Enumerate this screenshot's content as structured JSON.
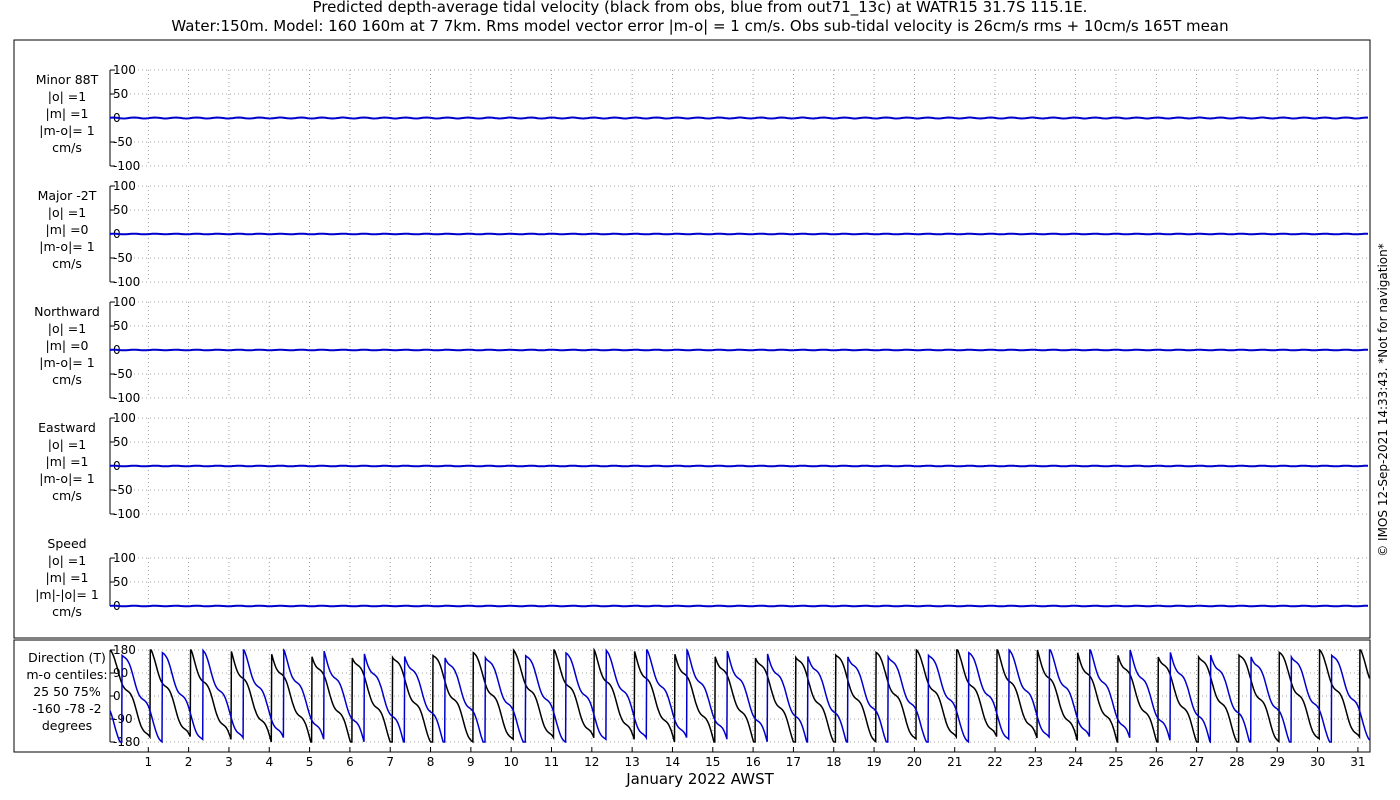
{
  "title_line1": "Predicted depth-average tidal velocity (black from obs, blue from out71_13c) at WATR15 31.7S 115.1E.",
  "title_line2": "Water:150m. Model: 160 160m at 7 7km. Rms model vector error |m-o| = 1 cm/s. Obs sub-tidal velocity is 26cm/s rms + 10cm/s 165T mean",
  "credit": "© IMOS 12-Sep-2021 14:33:43. *Not for navigation*",
  "colors": {
    "obs": "#000000",
    "model": "#0000cc",
    "grid": "#888888"
  },
  "chart_data": {
    "type": "line",
    "xlabel": "January 2022 AWST",
    "xlim": [
      0.05,
      31.3
    ],
    "x_tick_labels": [
      "1",
      "2",
      "3",
      "4",
      "5",
      "6",
      "7",
      "8",
      "9",
      "10",
      "11",
      "12",
      "13",
      "14",
      "15",
      "16",
      "17",
      "18",
      "19",
      "20",
      "21",
      "22",
      "23",
      "24",
      "25",
      "26",
      "27",
      "28",
      "29",
      "30",
      "31"
    ],
    "panels": [
      {
        "id": "minor",
        "label": [
          "Minor 88T",
          "|o| =1",
          "|m| =1",
          "|m-o|= 1",
          "cm/s"
        ],
        "ylim": [
          -100,
          100
        ],
        "yticks": [
          100,
          50,
          0,
          -50,
          -100
        ],
        "ytick_labels": [
          "100",
          "50",
          "0",
          "-50",
          "-100"
        ],
        "series": [
          {
            "type": "flat",
            "value": 0,
            "ripple": 1
          }
        ]
      },
      {
        "id": "major",
        "label": [
          "Major -2T",
          "|o| =1",
          "|m| =0",
          "|m-o|= 1",
          "cm/s"
        ],
        "ylim": [
          -100,
          100
        ],
        "yticks": [
          100,
          50,
          0,
          -50,
          -100
        ],
        "ytick_labels": [
          "100",
          "50",
          "0",
          "-50",
          "-100"
        ],
        "series": [
          {
            "type": "flat",
            "value": 0,
            "ripple": 0.5
          }
        ]
      },
      {
        "id": "north",
        "label": [
          "Northward",
          "|o| =1",
          "|m| =0",
          "|m-o|= 1",
          "cm/s"
        ],
        "ylim": [
          -100,
          100
        ],
        "yticks": [
          100,
          50,
          0,
          -50,
          -100
        ],
        "ytick_labels": [
          "100",
          "50",
          "0",
          "-50",
          "-100"
        ],
        "series": [
          {
            "type": "flat",
            "value": 0,
            "ripple": 0.5
          }
        ]
      },
      {
        "id": "east",
        "label": [
          "Eastward",
          "|o| =1",
          "|m| =1",
          "|m-o|= 1",
          "cm/s"
        ],
        "ylim": [
          -100,
          100
        ],
        "yticks": [
          100,
          50,
          0,
          -50,
          -100
        ],
        "ytick_labels": [
          "100",
          "50",
          "0",
          "-50",
          "-100"
        ],
        "series": [
          {
            "type": "flat",
            "value": 0,
            "ripple": 0.6
          }
        ]
      },
      {
        "id": "speed",
        "label": [
          "Speed",
          "|o| =1",
          "|m| =1",
          "|m|-|o|= 1",
          "cm/s"
        ],
        "ylim": [
          0,
          100
        ],
        "yticks": [
          100,
          50,
          0
        ],
        "ytick_labels": [
          "100",
          "50",
          "0"
        ],
        "series": [
          {
            "type": "flat",
            "value": 0,
            "ripple": 0.5
          }
        ]
      },
      {
        "id": "direction",
        "label": [
          "Direction (T)",
          "m-o centiles:",
          "25  50  75%",
          "-160  -78   -2",
          "degrees"
        ],
        "ylim": [
          -180,
          180
        ],
        "yticks": [
          180,
          90,
          0,
          -90,
          -180
        ],
        "ytick_labels": [
          "180",
          "90",
          "0",
          "-90",
          "-180"
        ],
        "series": [
          {
            "name": "obs",
            "type": "sawtooth",
            "period_days": 1.0,
            "phase_days": 0.05
          },
          {
            "name": "model",
            "type": "sawtooth",
            "period_days": 1.0,
            "phase_days": 0.35
          }
        ]
      }
    ]
  }
}
